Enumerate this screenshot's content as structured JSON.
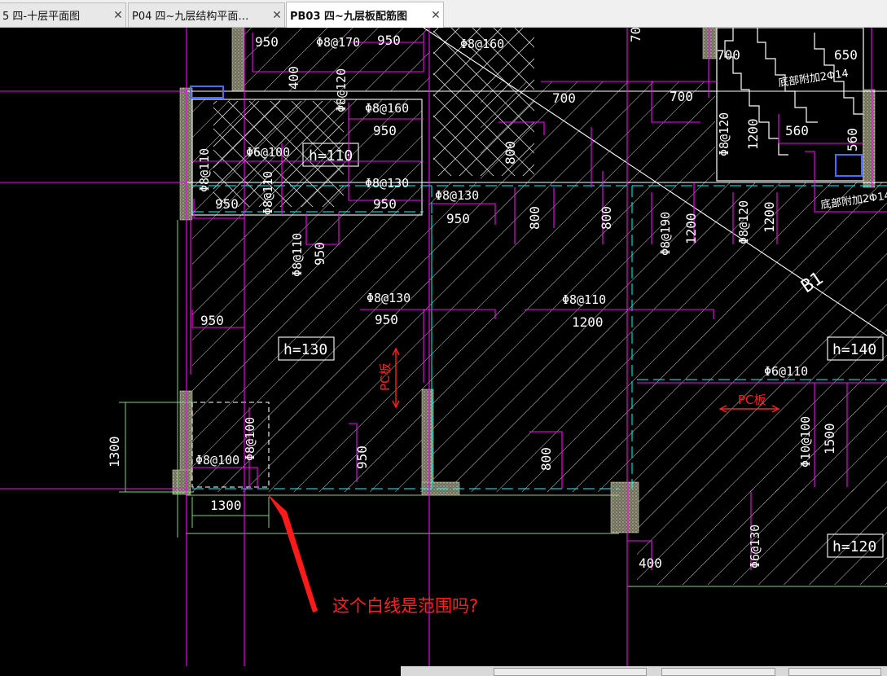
{
  "tabs": [
    {
      "label": "5 四-十层平面图",
      "close": "✕",
      "active": false
    },
    {
      "label": "P04 四~九层结构平面…",
      "close": "✕",
      "active": false
    },
    {
      "label": "PB03 四~九层板配筋图",
      "close": "✕",
      "active": true
    }
  ],
  "drawing": {
    "slab_heights": [
      "h=110",
      "h=130",
      "h=140",
      "h=120"
    ],
    "rebar": {
      "r1": "Φ8@170",
      "r2": "Φ8@160",
      "r3": "Φ8@160",
      "r4": "Φ8@120",
      "r5": "Φ6@100",
      "r6": "Φ8@130",
      "r7": "Φ8@110",
      "r8": "Φ8@110",
      "r9": "Φ8@130",
      "r10": "Φ8@110",
      "r11": "Φ8@130",
      "r12": "Φ8@110",
      "r13": "Φ8@190",
      "r14": "Φ8@120",
      "r15": "Φ8@120",
      "r16": "Φ6@110",
      "r17": "Φ8@100",
      "r18": "Φ8@100",
      "r19": "Φ10@100",
      "r20": "Φ6@130"
    },
    "dims": {
      "d1": "950",
      "d2": "950",
      "d3": "400",
      "d4": "700",
      "d5": "700",
      "d6": "700",
      "d7": "650",
      "d8": "950",
      "d9": "950",
      "d10": "950",
      "d11": "950",
      "d12": "950",
      "d13": "950",
      "d14": "950",
      "d15": "950",
      "d16": "800",
      "d17": "800",
      "d18": "800",
      "d19": "1200",
      "d20": "1200",
      "d21": "1200",
      "d22": "1200",
      "d23": "560",
      "d24": "560",
      "d25": "70",
      "d26": "1300",
      "d27": "1300",
      "d28": "950",
      "d29": "800",
      "d30": "1500",
      "d31": "400"
    },
    "notes": {
      "n1": "底部附加2Φ14",
      "n2": "底部附加2Φ14",
      "pc1": "PC板",
      "pc2": "PC板",
      "b1": "B1"
    }
  },
  "annotation": {
    "question": "这个白线是范围吗?"
  },
  "colors": {
    "background": "#000000",
    "magenta": "#ff00ff",
    "cyan": "#00ffff",
    "white": "#ffffff",
    "green": "#7fd27f",
    "red": "#ff2020",
    "wall": "#b0b0a0"
  }
}
